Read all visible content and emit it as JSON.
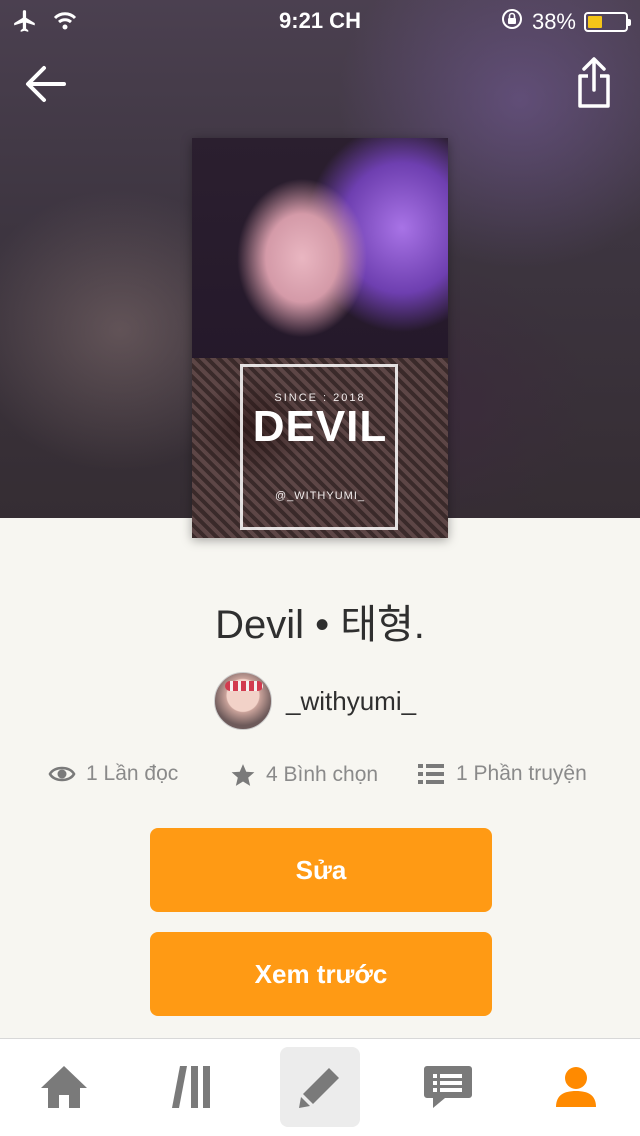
{
  "status_bar": {
    "time": "9:21 CH",
    "battery_percent": "38%",
    "battery_level": 0.38,
    "icons": [
      "airplane-icon",
      "wifi-icon",
      "orientation-lock-icon",
      "battery-icon"
    ]
  },
  "nav": {
    "back_icon": "arrow-left-icon",
    "share_icon": "share-icon"
  },
  "cover": {
    "since_text": "SINCE : 2018",
    "title_text": "DEVIL",
    "handle_text": "@_WITHYUMI_"
  },
  "story": {
    "title": "Devil • 태형.",
    "author": "_withyumi_"
  },
  "stats": {
    "reads": "1 Lần đọc",
    "votes": "4 Bình chọn",
    "parts": "1 Phần truyện"
  },
  "actions": {
    "edit_label": "Sửa",
    "preview_label": "Xem trước"
  },
  "tabbar": {
    "items": [
      "home-icon",
      "library-icon",
      "write-icon",
      "messages-icon",
      "profile-icon"
    ],
    "active": "write-icon"
  },
  "colors": {
    "accent": "#ff9a14",
    "background": "#f7f6f1",
    "icon_gray": "#7a7a7a"
  }
}
